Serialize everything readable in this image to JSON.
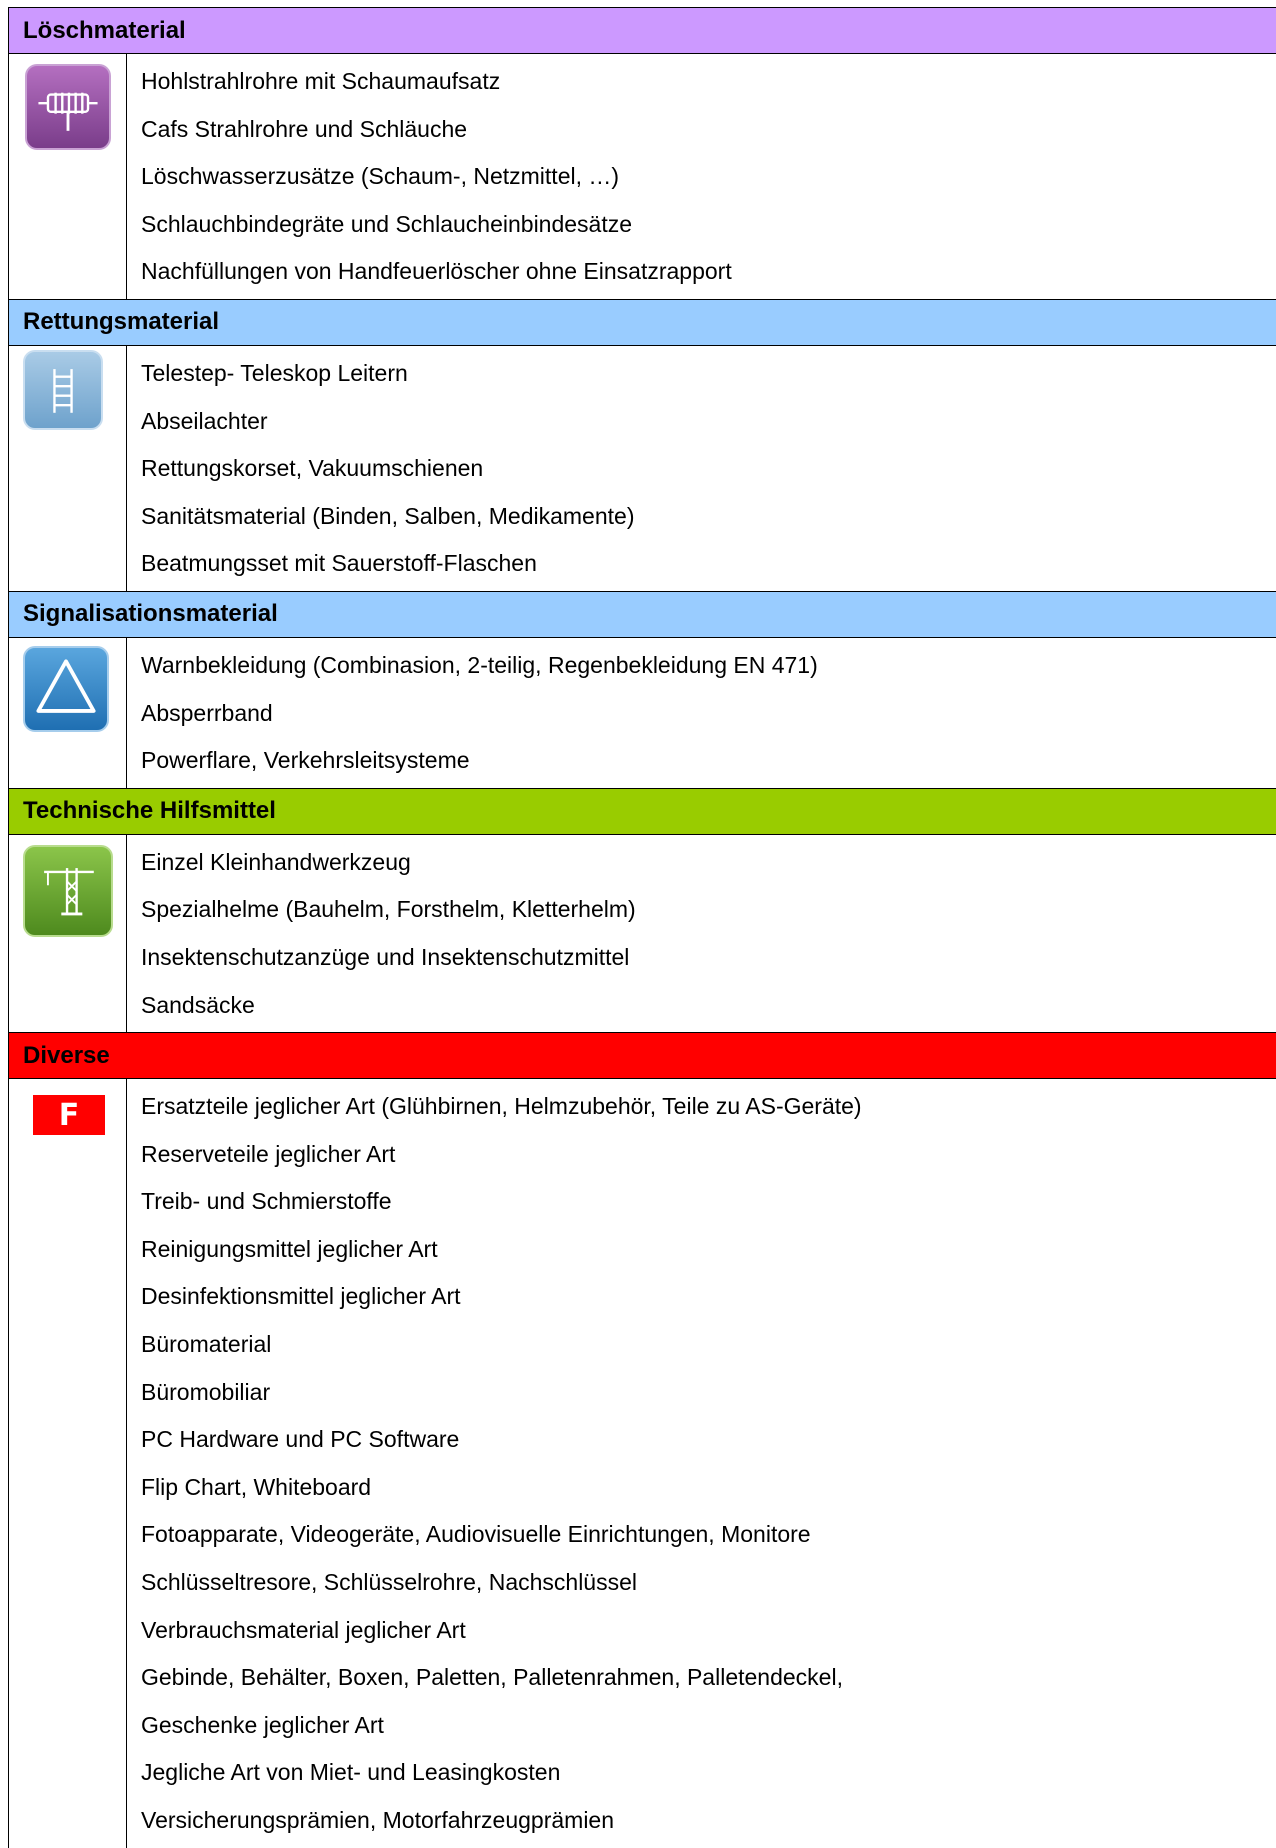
{
  "sections": [
    {
      "title": "Löschmaterial",
      "color": "#cc99ff",
      "icon": "fire-hose-icon",
      "items": [
        "Hohlstrahlrohre mit Schaumaufsatz",
        "Cafs Strahlrohre und Schläuche",
        "Löschwasserzusätze (Schaum-, Netzmittel, …)",
        "Schlauchbindegräte und Schlaucheinbindesätze",
        "Nachfüllungen von Handfeuerlöscher ohne Einsatzrapport"
      ]
    },
    {
      "title": "Rettungsmaterial",
      "color": "#99ccff",
      "icon": "ladder-icon",
      "items": [
        "Telestep- Teleskop Leitern",
        "Abseilachter",
        "Rettungskorset, Vakuumschienen",
        "Sanitätsmaterial (Binden, Salben, Medikamente)",
        "Beatmungsset mit Sauerstoff-Flaschen"
      ]
    },
    {
      "title": "Signalisationsmaterial",
      "color": "#99ccff",
      "icon": "warning-triangle-icon",
      "items": [
        "Warnbekleidung (Combinasion, 2-teilig, Regenbekleidung EN 471)",
        "Absperrband",
        "Powerflare, Verkehrsleitsysteme"
      ]
    },
    {
      "title": "Technische Hilfsmittel",
      "color": "#99cc00",
      "icon": "crane-icon",
      "items": [
        "Einzel Kleinhandwerkzeug",
        "Spezialhelme (Bauhelm, Forsthelm, Kletterhelm)",
        "Insektenschutzanzüge und Insektenschutzmittel",
        "Sandsäcke"
      ]
    },
    {
      "title": "Diverse",
      "color": "#ff0000",
      "icon": "f-logo-icon",
      "icon_letter": "F",
      "items": [
        "Ersatzteile jeglicher Art (Glühbirnen, Helmzubehör, Teile zu AS-Geräte)",
        "Reserveteile jeglicher Art",
        "Treib- und Schmierstoffe",
        "Reinigungsmittel jeglicher Art",
        "Desinfektionsmittel jeglicher Art",
        "Büromaterial",
        "Büromobiliar",
        "PC Hardware und PC Software",
        "Flip Chart, Whiteboard",
        "Fotoapparate, Videogeräte, Audiovisuelle Einrichtungen, Monitore",
        "Schlüsseltresore, Schlüsselrohre, Nachschlüssel",
        "Verbrauchsmaterial jeglicher Art",
        "Gebinde, Behälter, Boxen, Paletten, Palletenrahmen, Palletendeckel,",
        "Geschenke jeglicher Art",
        "Jegliche Art von Miet- und Leasingkosten",
        "Versicherungsprämien, Motorfahrzeugprämien"
      ]
    }
  ]
}
